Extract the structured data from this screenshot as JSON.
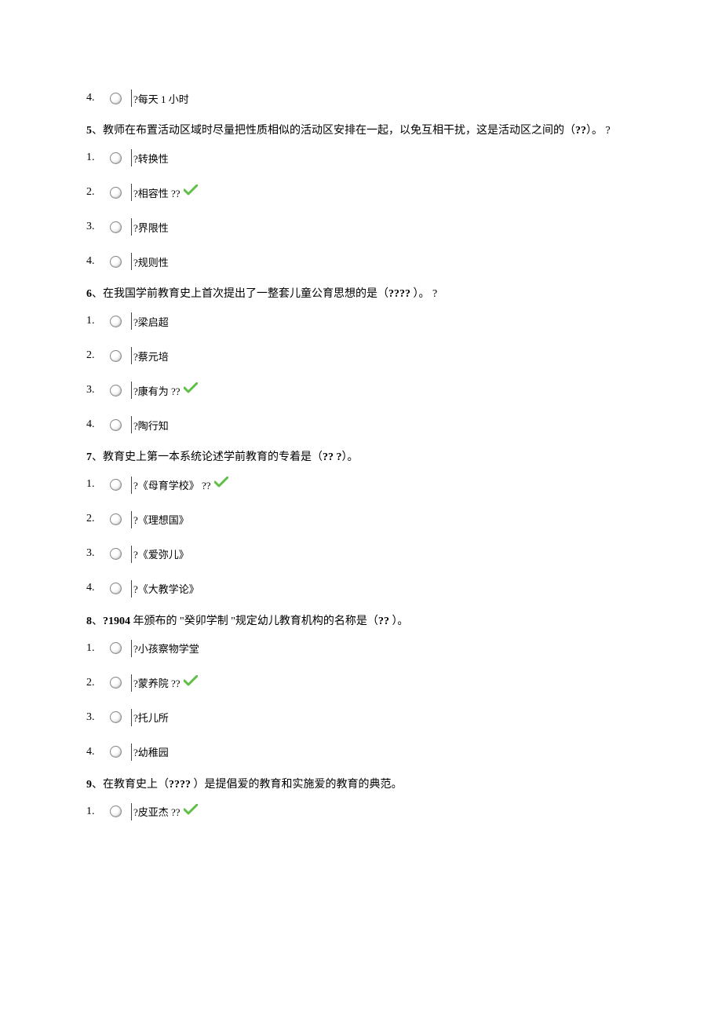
{
  "q4_options": [
    {
      "num": "4.",
      "text": "?每天  1 小时",
      "correct": false
    }
  ],
  "q5": {
    "num": "5",
    "sep": "、",
    "text_a": "教师在布置活动区域时尽量把性质相似的活动区安排在一起，以免互相干扰，这是活动区之间的（",
    "blank": "              ",
    "text_b": "??",
    "text_c": "）。  ?",
    "options": [
      {
        "num": "1.",
        "text": "?转换性",
        "correct": false
      },
      {
        "num": "2.",
        "text": "?相容性  ??",
        "correct": true
      },
      {
        "num": "3.",
        "text": "?界限性",
        "correct": false
      },
      {
        "num": "4.",
        "text": "?规则性",
        "correct": false
      }
    ]
  },
  "q6": {
    "num": "6",
    "sep": "、",
    "text_a": "在我国学前教育史上首次提出了一整套儿童公育思想的是（",
    "blank": "         ",
    "text_b": "????",
    "text_c": " ）。  ?",
    "options": [
      {
        "num": "1.",
        "text": "?梁启超",
        "correct": false
      },
      {
        "num": "2.",
        "text": "?蔡元培",
        "correct": false
      },
      {
        "num": "3.",
        "text": "?康有为  ??",
        "correct": true
      },
      {
        "num": "4.",
        "text": "?陶行知",
        "correct": false
      }
    ]
  },
  "q7": {
    "num": "7",
    "sep": "、",
    "text_a": "教育史上第一本系统论述学前教育的专着是（",
    "blank": "         ",
    "text_b": "?? ?",
    "text_c": "）。",
    "options": [
      {
        "num": "1.",
        "text": "?《母育学校》    ??",
        "correct": true
      },
      {
        "num": "2.",
        "text": "?《理想国》",
        "correct": false
      },
      {
        "num": "3.",
        "text": "?《爱弥儿》",
        "correct": false
      },
      {
        "num": "4.",
        "text": "?《大教学论》",
        "correct": false
      }
    ]
  },
  "q8": {
    "num": "8",
    "sep": "、",
    "text_pre": "?1904",
    "text_a": " 年颁布的   \"癸卯学制   \"规定幼儿教育机构的名称是（",
    "blank": "      ",
    "text_b": "??",
    "text_c": " ）。",
    "options": [
      {
        "num": "1.",
        "text": "?小孩察物学堂",
        "correct": false
      },
      {
        "num": "2.",
        "text": "?蒙养院  ??",
        "correct": true
      },
      {
        "num": "3.",
        "text": "?托儿所",
        "correct": false
      },
      {
        "num": "4.",
        "text": "?幼稚园",
        "correct": false
      }
    ]
  },
  "q9": {
    "num": "9",
    "sep": "、",
    "text_a": "在教育史上（",
    "blank": "    ",
    "text_b": "????",
    "text_c": " ）是提倡爱的教育和实施爱的教育的典范。",
    "options": [
      {
        "num": "1.",
        "text": "?皮亚杰  ??",
        "correct": true
      }
    ]
  }
}
